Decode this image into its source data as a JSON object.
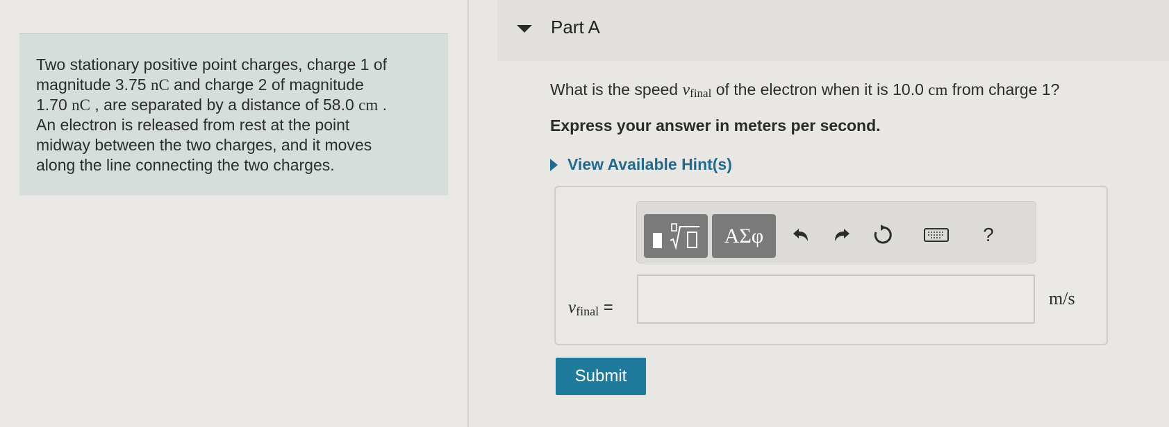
{
  "problem": {
    "line1": "Two stationary positive point charges, charge 1 of",
    "line2_pre": "magnitude 3.75 ",
    "line2_unit": "nC",
    "line2_post": " and charge 2 of magnitude",
    "line3_pre": "1.70 ",
    "line3_unit": "nC",
    "line3_mid": " , are separated by a distance of 58.0 ",
    "line3_unit2": "cm",
    "line3_post": " .",
    "line4": "An electron is released from rest at the point",
    "line5": "midway between the two charges, and it moves",
    "line6": "along the line connecting the two charges."
  },
  "part": {
    "title": "Part A"
  },
  "question": {
    "pre": "What is the speed ",
    "var": "v",
    "sub": "final",
    "mid": " of the electron when it is 10.0 ",
    "unit": "cm",
    "post": " from charge 1?"
  },
  "instruction": "Express your answer in meters per second.",
  "hint_label": "View Available Hint(s)",
  "toolbar": {
    "greek_label": "ΑΣφ",
    "help_label": "?"
  },
  "answer": {
    "var": "v",
    "sub": "final",
    "equals": " =",
    "value": "",
    "unit": "m/s"
  },
  "submit_label": "Submit",
  "colors": {
    "accent": "#236b8e",
    "submit": "#1f7a9c",
    "problem_bg": "#d5dedb",
    "toolbar_button": "#7a7a7a"
  },
  "icons": [
    "caret-down-icon",
    "caret-right-icon",
    "templates-icon",
    "undo-icon",
    "redo-icon",
    "reset-icon",
    "keyboard-icon",
    "help-icon"
  ]
}
